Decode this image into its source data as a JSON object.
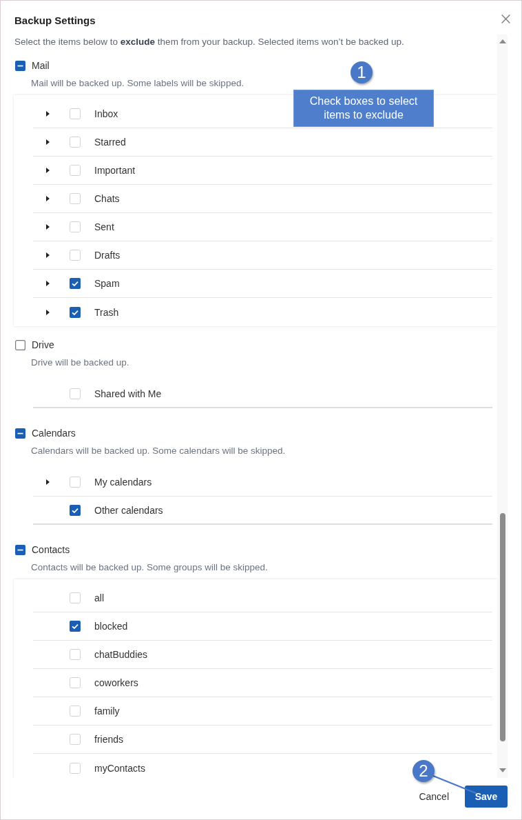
{
  "dialog": {
    "title": "Backup Settings",
    "intro": "Select the items below to **exclude** them from your backup. Selected items won’t be backed up."
  },
  "sections": [
    {
      "label": "Mail",
      "checked": false,
      "indeterminate": true,
      "description": "Mail will be backed up. Some labels will be skipped.",
      "framed": true,
      "items": [
        {
          "label": "Inbox",
          "checked": false,
          "expandable": true
        },
        {
          "label": "Starred",
          "checked": false,
          "expandable": true
        },
        {
          "label": "Important",
          "checked": false,
          "expandable": true
        },
        {
          "label": "Chats",
          "checked": false,
          "expandable": true
        },
        {
          "label": "Sent",
          "checked": false,
          "expandable": true
        },
        {
          "label": "Drafts",
          "checked": false,
          "expandable": true
        },
        {
          "label": "Spam",
          "checked": true,
          "expandable": true
        },
        {
          "label": "Trash",
          "checked": true,
          "expandable": true
        }
      ]
    },
    {
      "label": "Drive",
      "checked": false,
      "indeterminate": false,
      "description": "Drive will be backed up.",
      "framed": false,
      "items": [
        {
          "label": "Shared with Me",
          "checked": false,
          "expandable": false
        }
      ]
    },
    {
      "label": "Calendars",
      "checked": false,
      "indeterminate": true,
      "description": "Calendars will be backed up. Some calendars will be skipped.",
      "framed": false,
      "items": [
        {
          "label": "My calendars",
          "checked": false,
          "expandable": true
        },
        {
          "label": "Other calendars",
          "checked": true,
          "expandable": false
        }
      ]
    },
    {
      "label": "Contacts",
      "checked": false,
      "indeterminate": true,
      "description": "Contacts will be backed up. Some groups will be skipped.",
      "framed": true,
      "items": [
        {
          "label": "all",
          "checked": false,
          "expandable": false
        },
        {
          "label": "blocked",
          "checked": true,
          "expandable": false
        },
        {
          "label": "chatBuddies",
          "checked": false,
          "expandable": false
        },
        {
          "label": "coworkers",
          "checked": false,
          "expandable": false
        },
        {
          "label": "family",
          "checked": false,
          "expandable": false
        },
        {
          "label": "friends",
          "checked": false,
          "expandable": false
        },
        {
          "label": "myContacts",
          "checked": false,
          "expandable": false
        }
      ]
    }
  ],
  "footer": {
    "buttons": [
      {
        "label": "Cancel",
        "kind": "flat"
      },
      {
        "label": "Save",
        "kind": "filled"
      }
    ]
  },
  "annotations": [
    {
      "number": "1",
      "kind": "note",
      "note": "Check boxes to select items to exclude"
    },
    {
      "number": "2",
      "kind": "leader"
    }
  ]
}
